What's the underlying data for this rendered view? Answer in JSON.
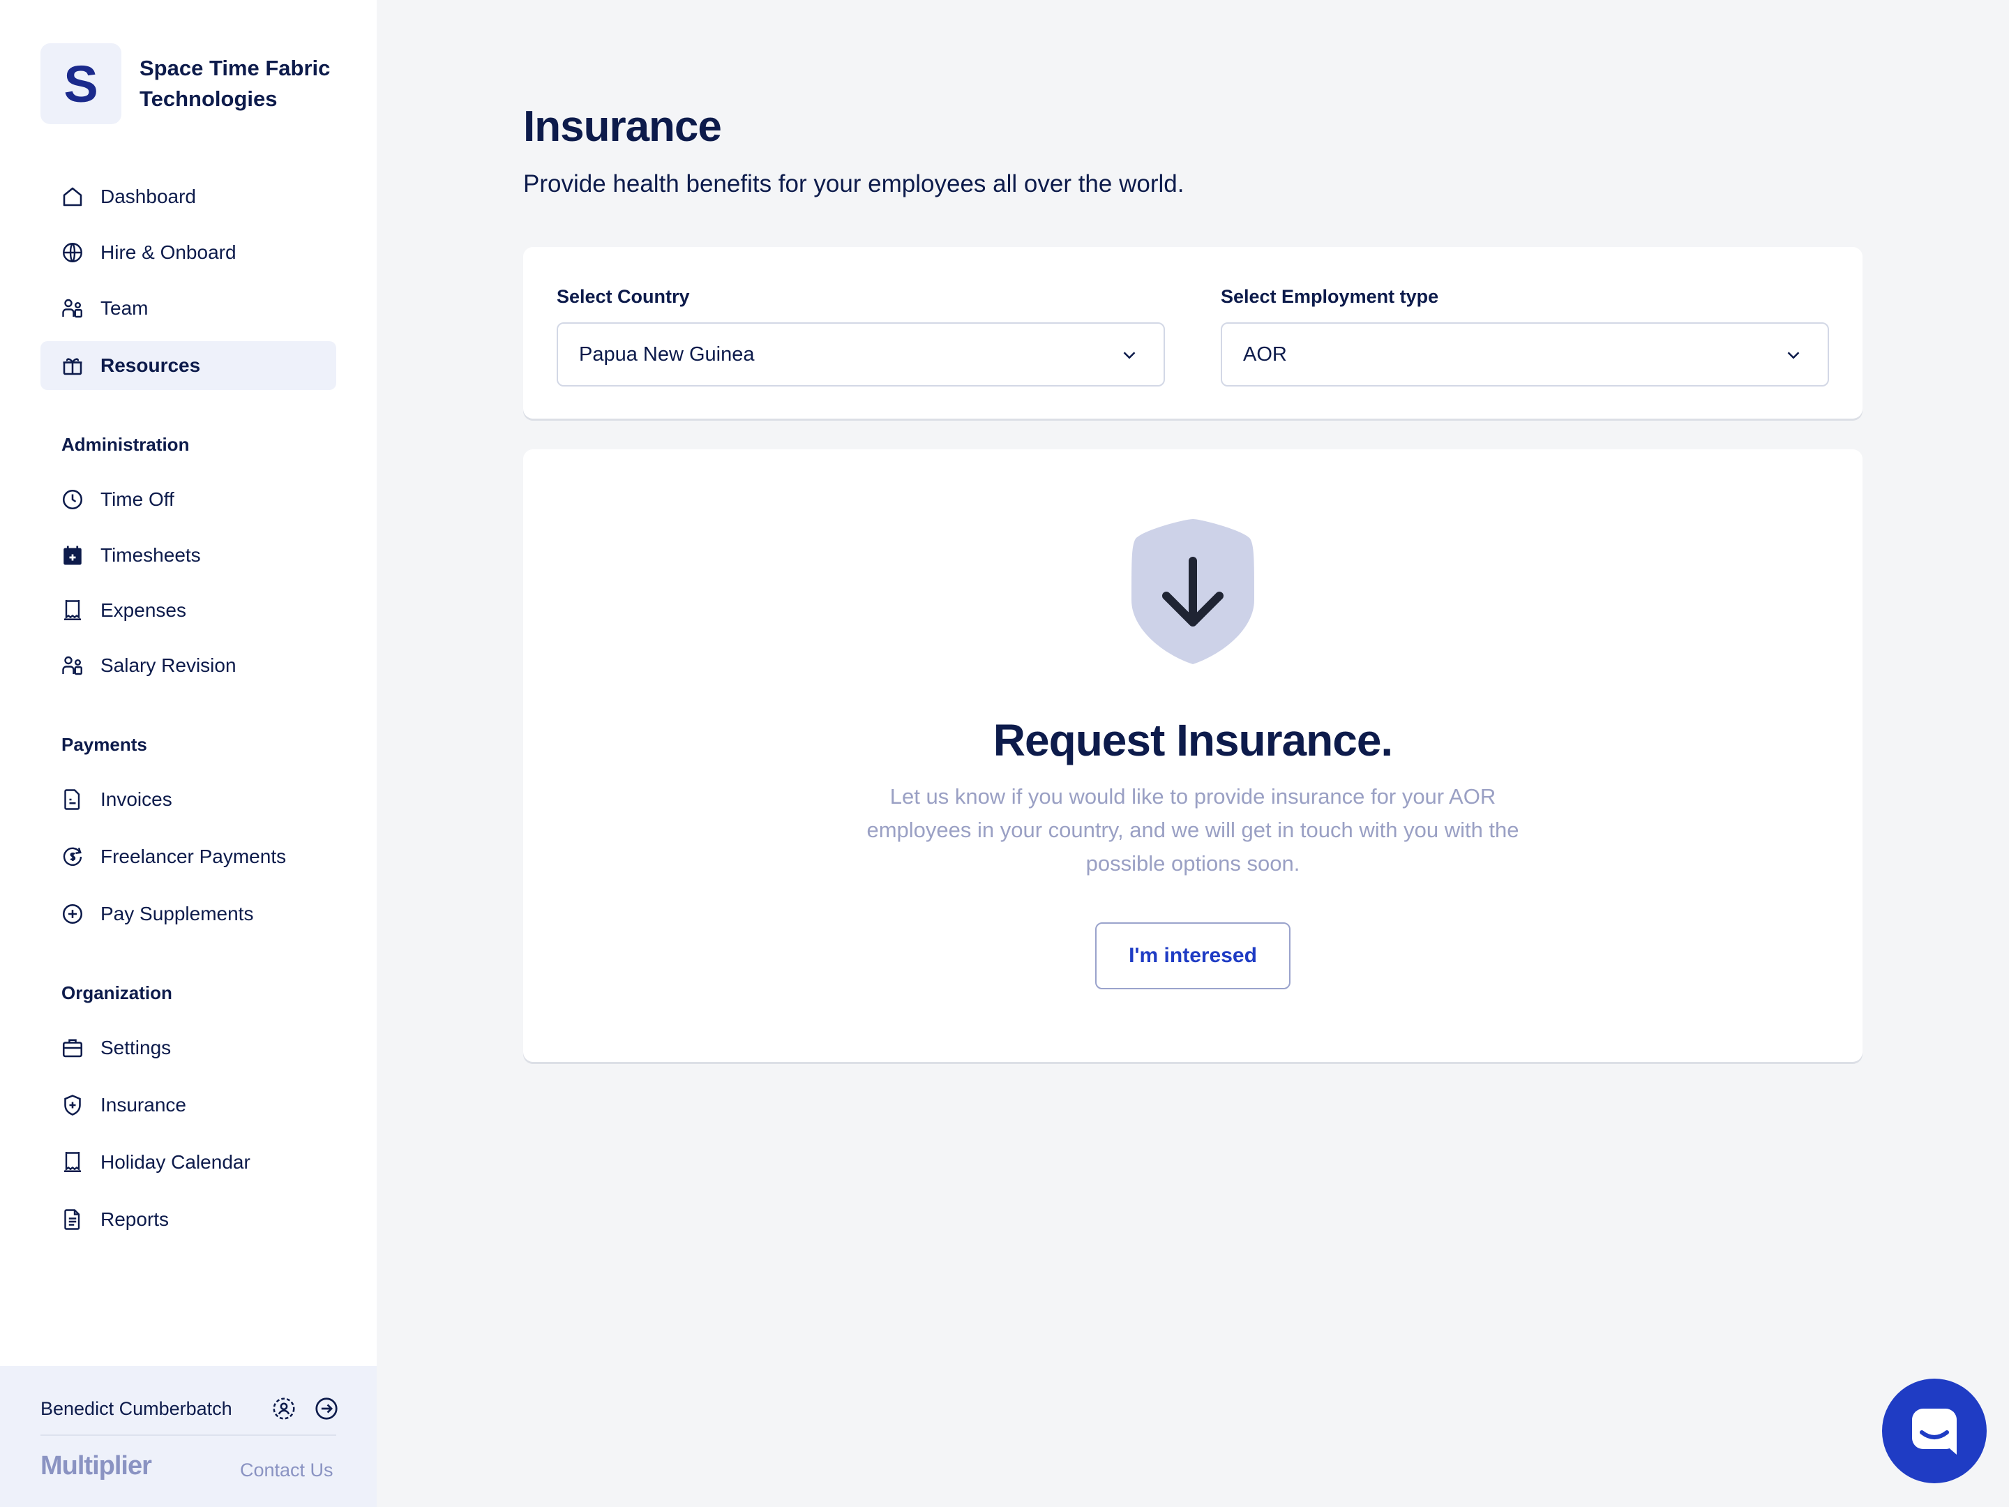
{
  "company": {
    "initial": "S",
    "name": "Space Time Fabric Technologies"
  },
  "nav": {
    "main": [
      {
        "label": "Dashboard",
        "icon": "home-icon"
      },
      {
        "label": "Hire & Onboard",
        "icon": "globe-icon"
      },
      {
        "label": "Team",
        "icon": "team-icon"
      },
      {
        "label": "Resources",
        "icon": "gift-icon",
        "active": true
      }
    ],
    "administration": {
      "title": "Administration",
      "items": [
        {
          "label": "Time Off",
          "icon": "clock-icon"
        },
        {
          "label": "Timesheets",
          "icon": "calendar-plus-icon"
        },
        {
          "label": "Expenses",
          "icon": "receipt-icon"
        },
        {
          "label": "Salary Revision",
          "icon": "team-icon"
        }
      ]
    },
    "payments": {
      "title": "Payments",
      "items": [
        {
          "label": "Invoices",
          "icon": "invoice-icon"
        },
        {
          "label": "Freelancer Payments",
          "icon": "dollar-refresh-icon"
        },
        {
          "label": "Pay Supplements",
          "icon": "plus-circle-icon"
        }
      ]
    },
    "organization": {
      "title": "Organization",
      "items": [
        {
          "label": "Settings",
          "icon": "briefcase-icon"
        },
        {
          "label": "Insurance",
          "icon": "shield-plus-icon"
        },
        {
          "label": "Holiday Calendar",
          "icon": "receipt-icon"
        },
        {
          "label": "Reports",
          "icon": "document-icon"
        }
      ]
    }
  },
  "footer": {
    "user_name": "Benedict Cumberbatch",
    "brand": "Multiplier",
    "contact_label": "Contact Us"
  },
  "page": {
    "title": "Insurance",
    "subtitle": "Provide health benefits for your employees all over the world."
  },
  "filters": {
    "country": {
      "label": "Select Country",
      "value": "Papua New Guinea"
    },
    "employment_type": {
      "label": "Select Employment type",
      "value": "AOR"
    }
  },
  "request": {
    "title": "Request Insurance.",
    "description": "Let us know if you would like to provide insurance for your AOR employees in your country, and we will get in touch with you with the possible options soon.",
    "button_label": "I'm interesed"
  },
  "colors": {
    "primary": "#1F3CC4",
    "navy_text": "#0D1B4B",
    "muted_text": "#9AA0C4",
    "active_bg": "#EEF1FA",
    "page_bg": "#F4F5F7",
    "shield_fill": "#CDD2E8"
  }
}
